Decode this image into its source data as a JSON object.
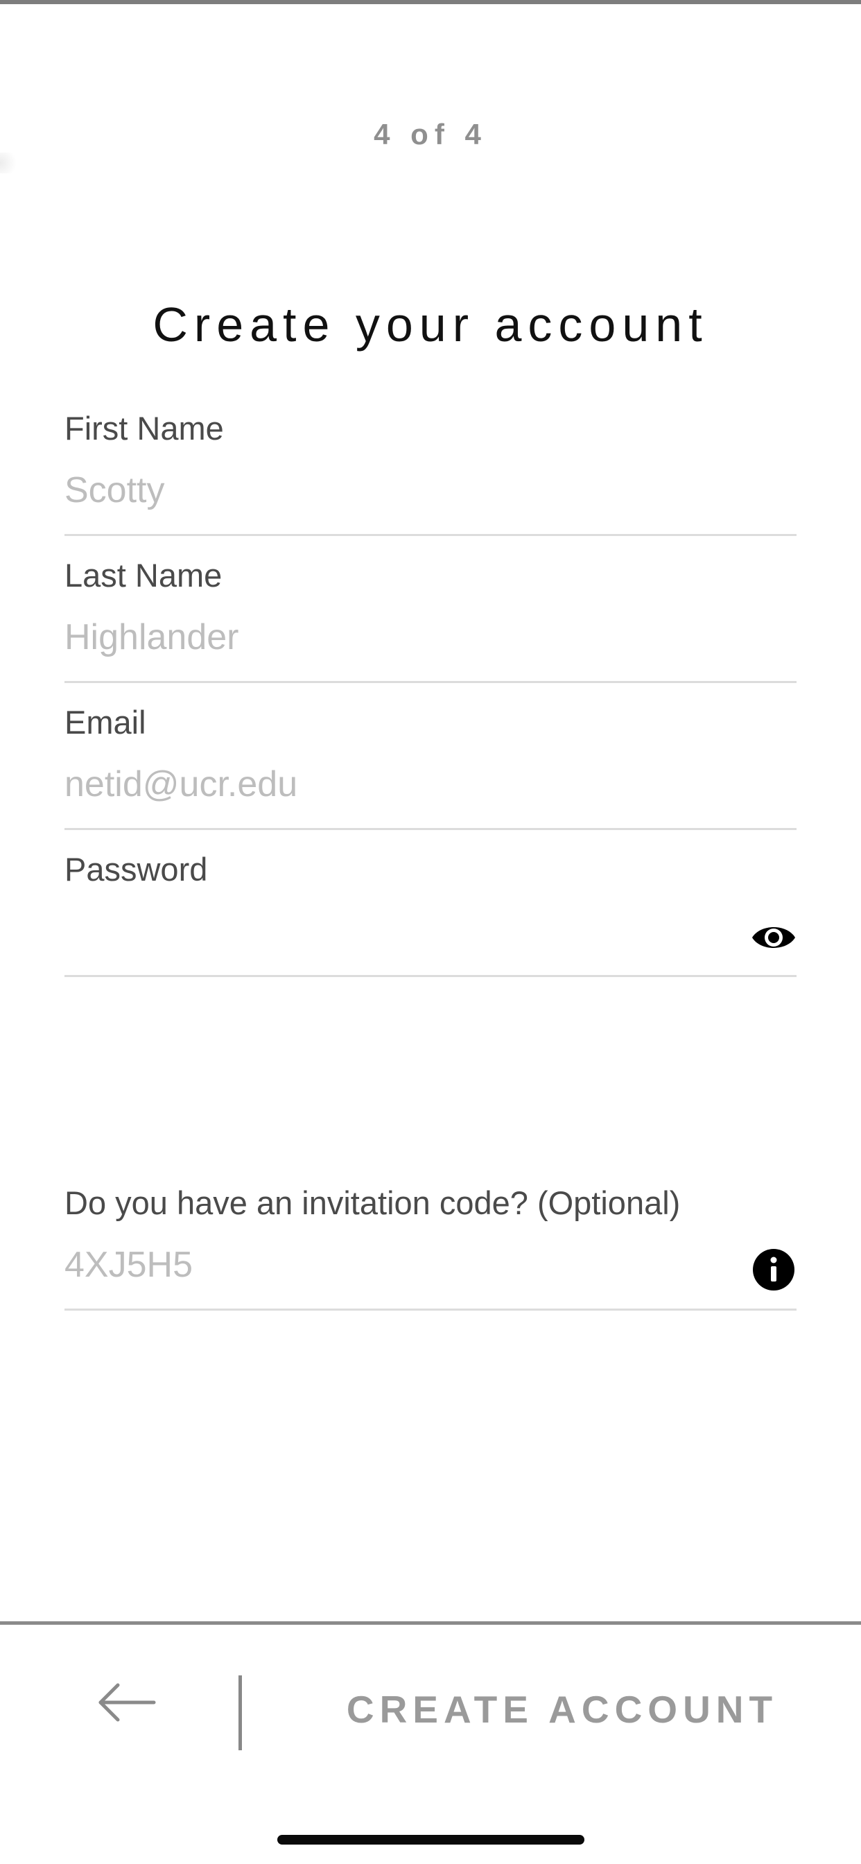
{
  "header": {
    "step": "4 of 4",
    "title": "Create your account"
  },
  "form": {
    "first_name": {
      "label": "First Name",
      "placeholder": "Scotty",
      "value": ""
    },
    "last_name": {
      "label": "Last Name",
      "placeholder": "Highlander",
      "value": ""
    },
    "email": {
      "label": "Email",
      "placeholder": "netid@ucr.edu",
      "value": ""
    },
    "password": {
      "label": "Password",
      "placeholder": "",
      "value": ""
    },
    "invitation_code": {
      "label": "Do you have an invitation code? (Optional)",
      "placeholder": "4XJ5H5",
      "value": ""
    }
  },
  "icons": {
    "password_toggle": "eye-icon",
    "invitation_info": "info-icon",
    "back": "arrow-left-icon"
  },
  "footer": {
    "create_label": "CREATE ACCOUNT"
  },
  "colors": {
    "rule": "#7d7d7d",
    "muted_text": "#9a9a9a",
    "placeholder": "#bdbdbd",
    "icon": "#000000"
  }
}
